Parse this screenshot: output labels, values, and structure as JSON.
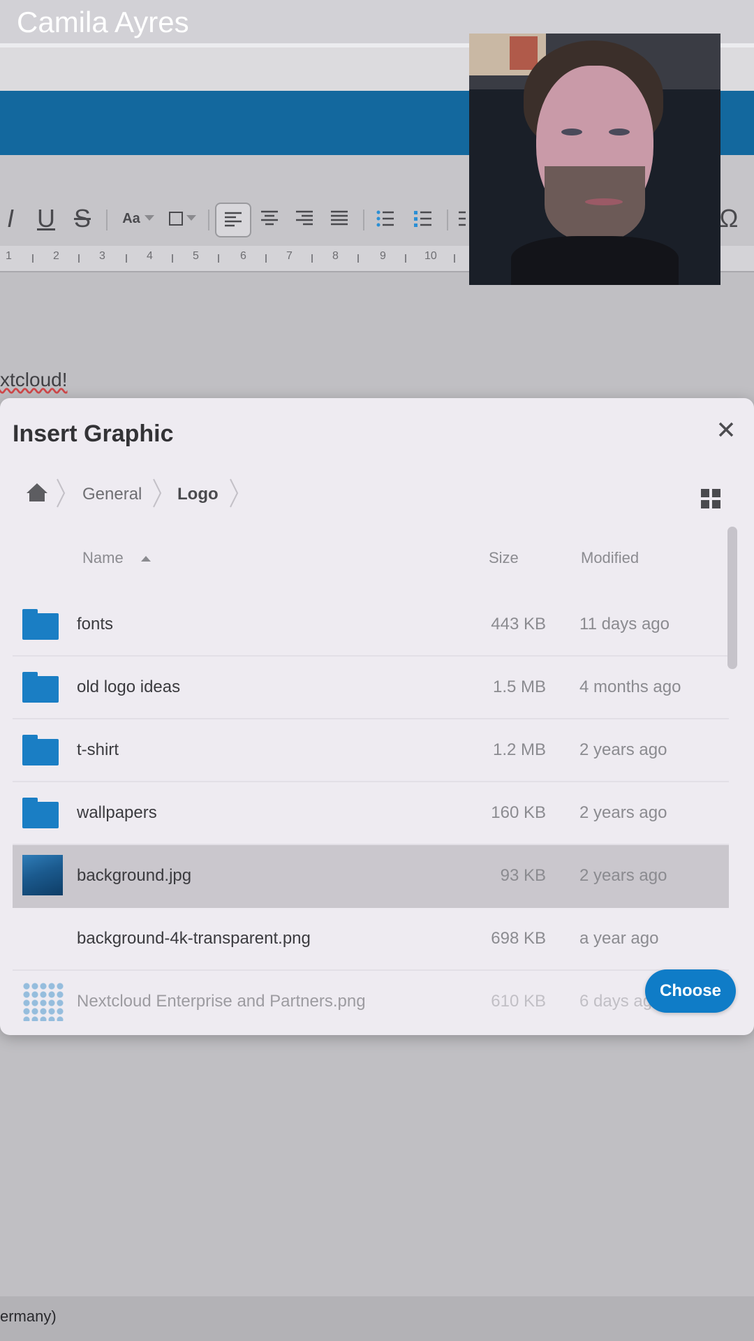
{
  "call": {
    "caller_name": "Camila Ayres"
  },
  "editor": {
    "toolbar": {
      "italic": "I",
      "underline": "U",
      "strike": "S",
      "font_size": "Aa",
      "special_char": "Ω"
    },
    "ruler_numbers": [
      "1",
      "2",
      "3",
      "4",
      "5",
      "6",
      "7",
      "8",
      "9",
      "10"
    ],
    "doc_text": "xtcloud!",
    "status_text": "ermany)"
  },
  "dialog": {
    "title": "Insert Graphic",
    "close_glyph": "✕",
    "breadcrumbs": [
      {
        "label": "General"
      },
      {
        "label": "Logo"
      }
    ],
    "columns": {
      "name": "Name",
      "size": "Size",
      "modified": "Modified"
    },
    "files": [
      {
        "name": "fonts",
        "size": "443 KB",
        "modified": "11 days ago",
        "icon": "folder-icon"
      },
      {
        "name": "old logo ideas",
        "size": "1.5 MB",
        "modified": "4 months ago",
        "icon": "folder-icon"
      },
      {
        "name": "t-shirt",
        "size": "1.2 MB",
        "modified": "2 years ago",
        "icon": "folder-icon"
      },
      {
        "name": "wallpapers",
        "size": "160 KB",
        "modified": "2 years ago",
        "icon": "folder-icon"
      },
      {
        "name": "background.jpg",
        "size": "93 KB",
        "modified": "2 years ago",
        "icon": "image-thumbnail",
        "selected": true
      },
      {
        "name": "background-4k-transparent.png",
        "size": "698 KB",
        "modified": "a year ago",
        "icon": "none"
      },
      {
        "name": "Nextcloud Enterprise and Partners.png",
        "size": "610 KB",
        "modified": "6 days ago",
        "icon": "image-thumbnail"
      }
    ],
    "choose_label": "Choose"
  },
  "colors": {
    "accent": "#0f7cc7",
    "header_blue": "#13689e",
    "folder": "#1a7ec4"
  }
}
